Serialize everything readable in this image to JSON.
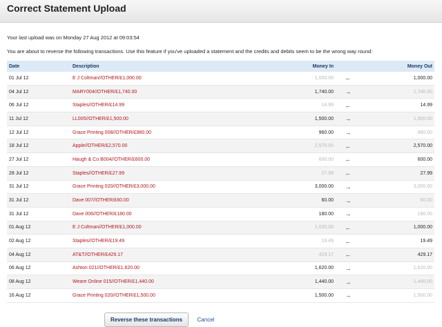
{
  "window": {
    "title": "Correct Statement Upload"
  },
  "info": {
    "last_upload": "Your last upload was on Monday 27 Aug 2012 at 09:03:54",
    "instructions": "You are about to reverse the following transactions. Use this feature if you've uploaded a statement and the credits and debits seem to be the wrong way round:"
  },
  "table": {
    "headers": {
      "date": "Date",
      "description": "Description",
      "money_in": "Money In",
      "money_out": "Money Out"
    },
    "rows": [
      {
        "date": "01 Jul 12",
        "description": "E J Coltman//OTHER/£1,000.00",
        "money_in": "1,000.00",
        "money_out": "1,000.00",
        "arrow": "←",
        "direction": "out"
      },
      {
        "date": "04 Jul 12",
        "description": "MARY004//OTHER/£1,740.00",
        "money_in": "1,740.00",
        "money_out": "1,740.00",
        "arrow": "→",
        "direction": "in"
      },
      {
        "date": "06 Jul 12",
        "description": "Staples//OTHER/£14.99",
        "money_in": "14.99",
        "money_out": "14.99",
        "arrow": "←",
        "direction": "out"
      },
      {
        "date": "11 Jul 12",
        "description": "LL005//OTHER/£1,500.00",
        "money_in": "1,500.00",
        "money_out": "1,500.00",
        "arrow": "→",
        "direction": "in"
      },
      {
        "date": "12 Jul 12",
        "description": "Grace Printing 008//OTHER/£960.00",
        "money_in": "960.00",
        "money_out": "960.00",
        "arrow": "→",
        "direction": "in"
      },
      {
        "date": "18 Jul 12",
        "description": "Apple//OTHER/£2,570.00",
        "money_in": "2,570.00",
        "money_out": "2,570.00",
        "arrow": "←",
        "direction": "out"
      },
      {
        "date": "27 Jul 12",
        "description": "Haugh & Co B004//OTHER/£600.00",
        "money_in": "600.00",
        "money_out": "600.00",
        "arrow": "←",
        "direction": "out"
      },
      {
        "date": "28 Jul 12",
        "description": "Staples//OTHER/£27.99",
        "money_in": "27.99",
        "money_out": "27.99",
        "arrow": "←",
        "direction": "out"
      },
      {
        "date": "31 Jul 12",
        "description": "Grace Printing 020//OTHER/£3,000.00",
        "money_in": "3,000.00",
        "money_out": "3,000.00",
        "arrow": "→",
        "direction": "in"
      },
      {
        "date": "31 Jul 12",
        "description": "Dave 007//OTHER/£60.00",
        "money_in": "60.00",
        "money_out": "60.00",
        "arrow": "→",
        "direction": "in"
      },
      {
        "date": "31 Jul 12",
        "description": "Dave 006//OTHER/£180.00",
        "money_in": "180.00",
        "money_out": "180.00",
        "arrow": "→",
        "direction": "in"
      },
      {
        "date": "01 Aug 12",
        "description": "E J Coltman//OTHER/£1,000.00",
        "money_in": "1,000.00",
        "money_out": "1,000.00",
        "arrow": "←",
        "direction": "out"
      },
      {
        "date": "02 Aug 12",
        "description": "Staples//OTHER/£19.49",
        "money_in": "19.49",
        "money_out": "19.49",
        "arrow": "←",
        "direction": "out"
      },
      {
        "date": "04 Aug 12",
        "description": "AT&T//OTHER/£429.17",
        "money_in": "429.17",
        "money_out": "429.17",
        "arrow": "←",
        "direction": "out"
      },
      {
        "date": "06 Aug 12",
        "description": "Ashton 021//OTHER/£1,620.00",
        "money_in": "1,620.00",
        "money_out": "1,620.00",
        "arrow": "→",
        "direction": "in"
      },
      {
        "date": "08 Aug 12",
        "description": "Weare Online 015//OTHER/£1,440.00",
        "money_in": "1,440.00",
        "money_out": "1,440.00",
        "arrow": "→",
        "direction": "in"
      },
      {
        "date": "16 Aug 12",
        "description": "Grace Printing 020//OTHER/£1,500.00",
        "money_in": "1,500.00",
        "money_out": "1,500.00",
        "arrow": "→",
        "direction": "in"
      }
    ]
  },
  "actions": {
    "reverse_label": "Reverse these transactions",
    "cancel_label": "Cancel"
  },
  "colors": {
    "header_bg": "#dce9f6",
    "description_text": "#b3161c",
    "muted_amount": "#b9b9b9",
    "link": "#1e4d8c"
  }
}
